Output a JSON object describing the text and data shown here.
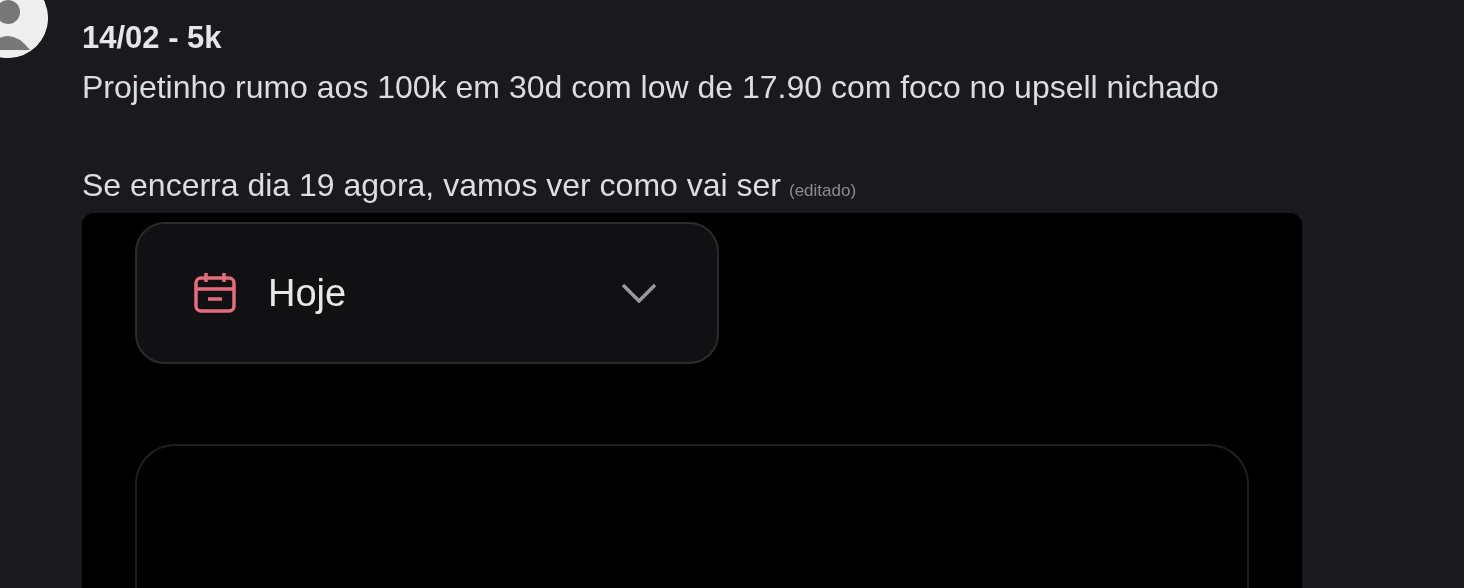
{
  "message": {
    "header": "14/02 - 5k",
    "lines": [
      "Projetinho rumo aos 100k em 30d com low de 17.90 com foco no upsell nichado",
      "Se encerra dia 19 agora, vamos ver como vai ser"
    ],
    "edited": "(editado)"
  },
  "attachment": {
    "date_filter": {
      "label": "Hoje"
    }
  }
}
